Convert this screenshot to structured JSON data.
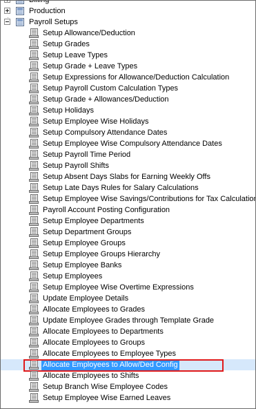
{
  "tree": {
    "roots": [
      {
        "label": "Billing",
        "expanded": false
      },
      {
        "label": "Production",
        "expanded": false
      },
      {
        "label": "Payroll Setups",
        "expanded": true
      }
    ],
    "items": [
      "Setup Allowance/Deduction",
      "Setup Grades",
      "Setup Leave Types",
      "Setup Grade + Leave Types",
      "Setup Expressions for Allowance/Deduction Calculation",
      "Setup Payroll Custom Calculation Types",
      "Setup Grade + Allowances/Deduction",
      "Setup Holidays",
      "Setup Employee Wise Holidays",
      "Setup Compulsory Attendance Dates",
      "Setup Employee Wise Compulsory Attendance Dates",
      "Setup Payroll Time Period",
      "Setup Payroll Shifts",
      "Setup Absent Days Slabs for Earning Weekly Offs",
      "Setup Late Days Rules for Salary Calculations",
      "Setup Employee Wise Savings/Contributions for Tax Calculation",
      "Payroll Account Posting Configuration",
      "Setup Employee Departments",
      "Setup Department Groups",
      "Setup Employee Groups",
      "Setup Employee Groups Hierarchy",
      "Setup Employee Banks",
      "Setup Employees",
      "Setup Employee Wise Overtime Expressions",
      "Update Employee Details",
      "Allocate Employees to Grades",
      "Update Employee Grades through Template Grade",
      "Allocate Employees to Departments",
      "Allocate Employees to Groups",
      "Allocate Employees to Employee Types",
      "Allocate Employees to Allow/Ded Config",
      "Allocate Employees to Shifts",
      "Setup Branch Wise Employee Codes",
      "Setup Employee Wise Earned Leaves"
    ],
    "selected_item": "Allocate Employees to Allow/Ded Config",
    "colors": {
      "selection": "#3399ff",
      "highlight_box": "#e0191a"
    },
    "icons": {
      "root": "folder-icon",
      "leaf": "document-icon"
    }
  }
}
